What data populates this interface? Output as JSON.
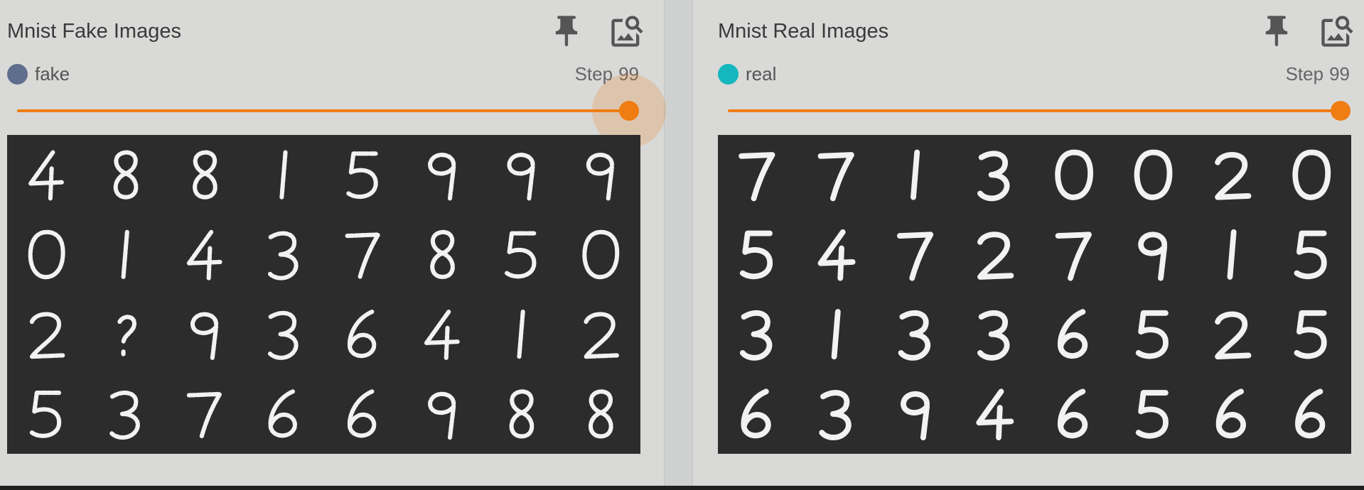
{
  "cards": {
    "fake": {
      "title": "Mnist Fake Images",
      "run_label": "fake",
      "run_color": "#5f6e8d",
      "step_prefix": "Step",
      "step_value": "99",
      "slider_fraction": 1.0,
      "grid_rows": 4,
      "grid_cols": 8,
      "image_description_icon": "generated-digit-grid"
    },
    "real": {
      "title": "Mnist Real Images",
      "run_label": "real",
      "run_color": "#14b7bd",
      "step_prefix": "Step",
      "step_value": "99",
      "slider_fraction": 1.0,
      "grid_rows": 4,
      "grid_cols": 8
    }
  },
  "icons": {
    "pin": "pin-icon",
    "image_search": "image-search-icon"
  },
  "colors": {
    "accent": "#ef7d12",
    "image_background": "#2c2c2c",
    "card_background": "#d9d9d8"
  }
}
